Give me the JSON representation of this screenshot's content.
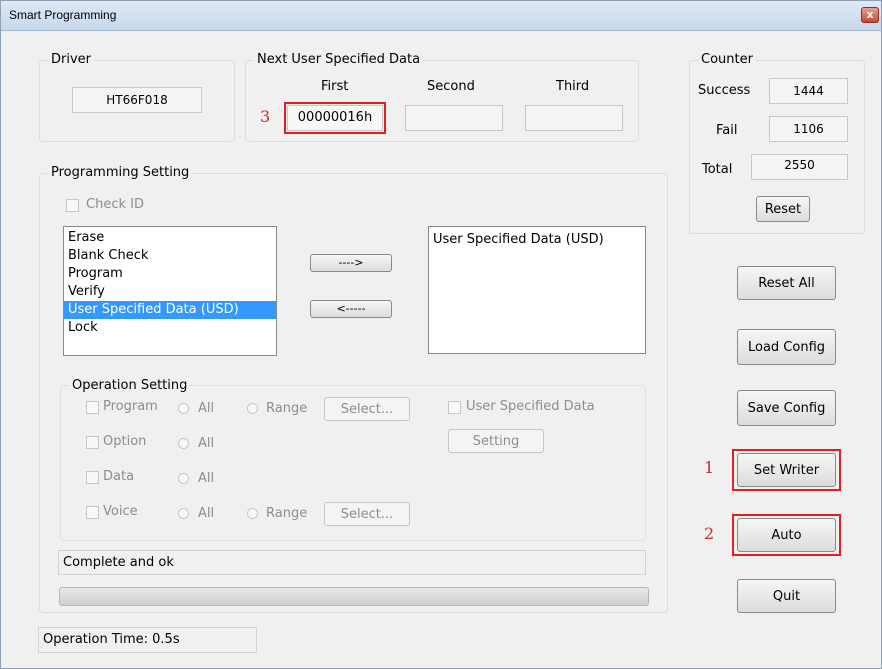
{
  "window": {
    "title": "Smart Programming",
    "close_glyph": "x"
  },
  "driver": {
    "group_title": "Driver",
    "value": "HT66F018"
  },
  "usd": {
    "group_title": "Next User Specified Data",
    "first_label": "First",
    "second_label": "Second",
    "third_label": "Third",
    "first_value": "00000016h",
    "second_value": "",
    "third_value": ""
  },
  "counter": {
    "group_title": "Counter",
    "success_label": "Success",
    "success_value": "1444",
    "fail_label": "Fail",
    "fail_value": "1106",
    "total_label": "Total",
    "total_value": "2550",
    "reset_label": "Reset"
  },
  "programming": {
    "group_title": "Programming Setting",
    "check_id_label": "Check ID",
    "left_items": [
      "Erase",
      "Blank Check",
      "Program",
      "Verify",
      "User Specified Data (USD)",
      "Lock"
    ],
    "selected_index": 4,
    "right_items": [
      "User Specified Data (USD)"
    ],
    "add_label": "---->",
    "remove_label": "<-----"
  },
  "operation": {
    "group_title": "Operation Setting",
    "program_label": "Program",
    "option_label": "Option",
    "data_label": "Data",
    "voice_label": "Voice",
    "all_label": "All",
    "range_label": "Range",
    "select_label": "Select...",
    "usd_label": "User Specified Data",
    "setting_label": "Setting"
  },
  "status": {
    "text": "Complete and ok",
    "progress": 0
  },
  "operation_time": "Operation Time: 0.5s",
  "buttons": {
    "reset_all": "Reset All",
    "load_config": "Load Config",
    "save_config": "Save Config",
    "set_writer": "Set Writer",
    "auto": "Auto",
    "quit": "Quit"
  },
  "annotations": {
    "one": "1",
    "two": "2",
    "three": "3"
  },
  "colors": {
    "highlight": "#e01f25",
    "selection": "#3399ff"
  }
}
